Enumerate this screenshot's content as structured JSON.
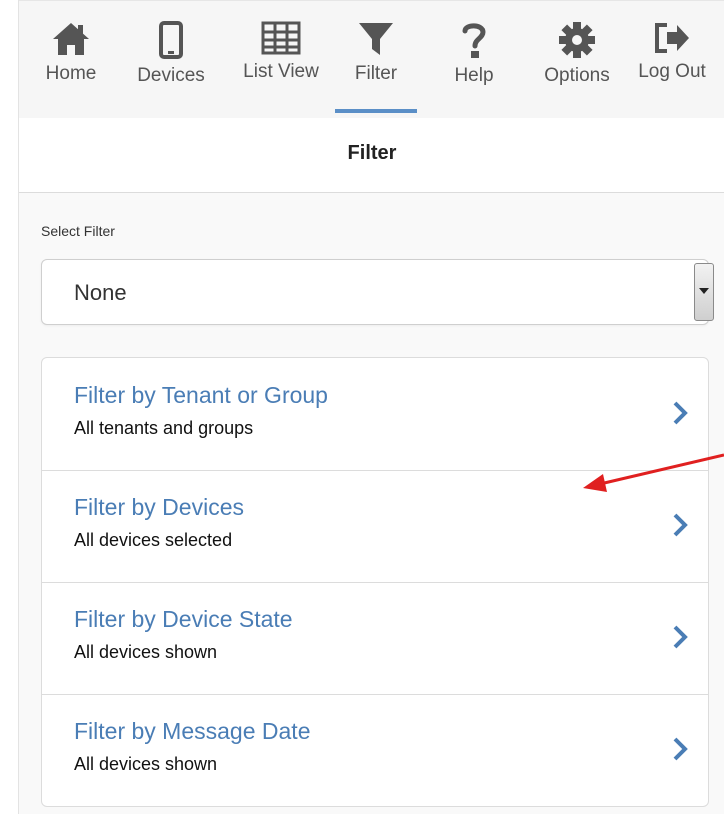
{
  "nav": {
    "items": [
      {
        "label": "Home",
        "icon": "home-icon"
      },
      {
        "label": "Devices",
        "icon": "device-icon"
      },
      {
        "label": "List View",
        "icon": "grid-icon"
      },
      {
        "label": "Filter",
        "icon": "filter-icon",
        "active": true
      },
      {
        "label": "Help",
        "icon": "question-icon"
      },
      {
        "label": "Options",
        "icon": "gear-icon"
      },
      {
        "label": "Log Out",
        "icon": "logout-icon"
      }
    ],
    "active_color": "#5b8fc7"
  },
  "page": {
    "title": "Filter"
  },
  "select_filter": {
    "label": "Select Filter",
    "value": "None"
  },
  "filters": [
    {
      "title": "Filter by Tenant or Group",
      "subtitle": "All tenants and groups"
    },
    {
      "title": "Filter by Devices",
      "subtitle": "All devices selected"
    },
    {
      "title": "Filter by Device State",
      "subtitle": "All devices shown"
    },
    {
      "title": "Filter by Message Date",
      "subtitle": "All devices shown"
    }
  ],
  "colors": {
    "link": "#4a7db5",
    "arrow_annotation": "#e02020"
  }
}
